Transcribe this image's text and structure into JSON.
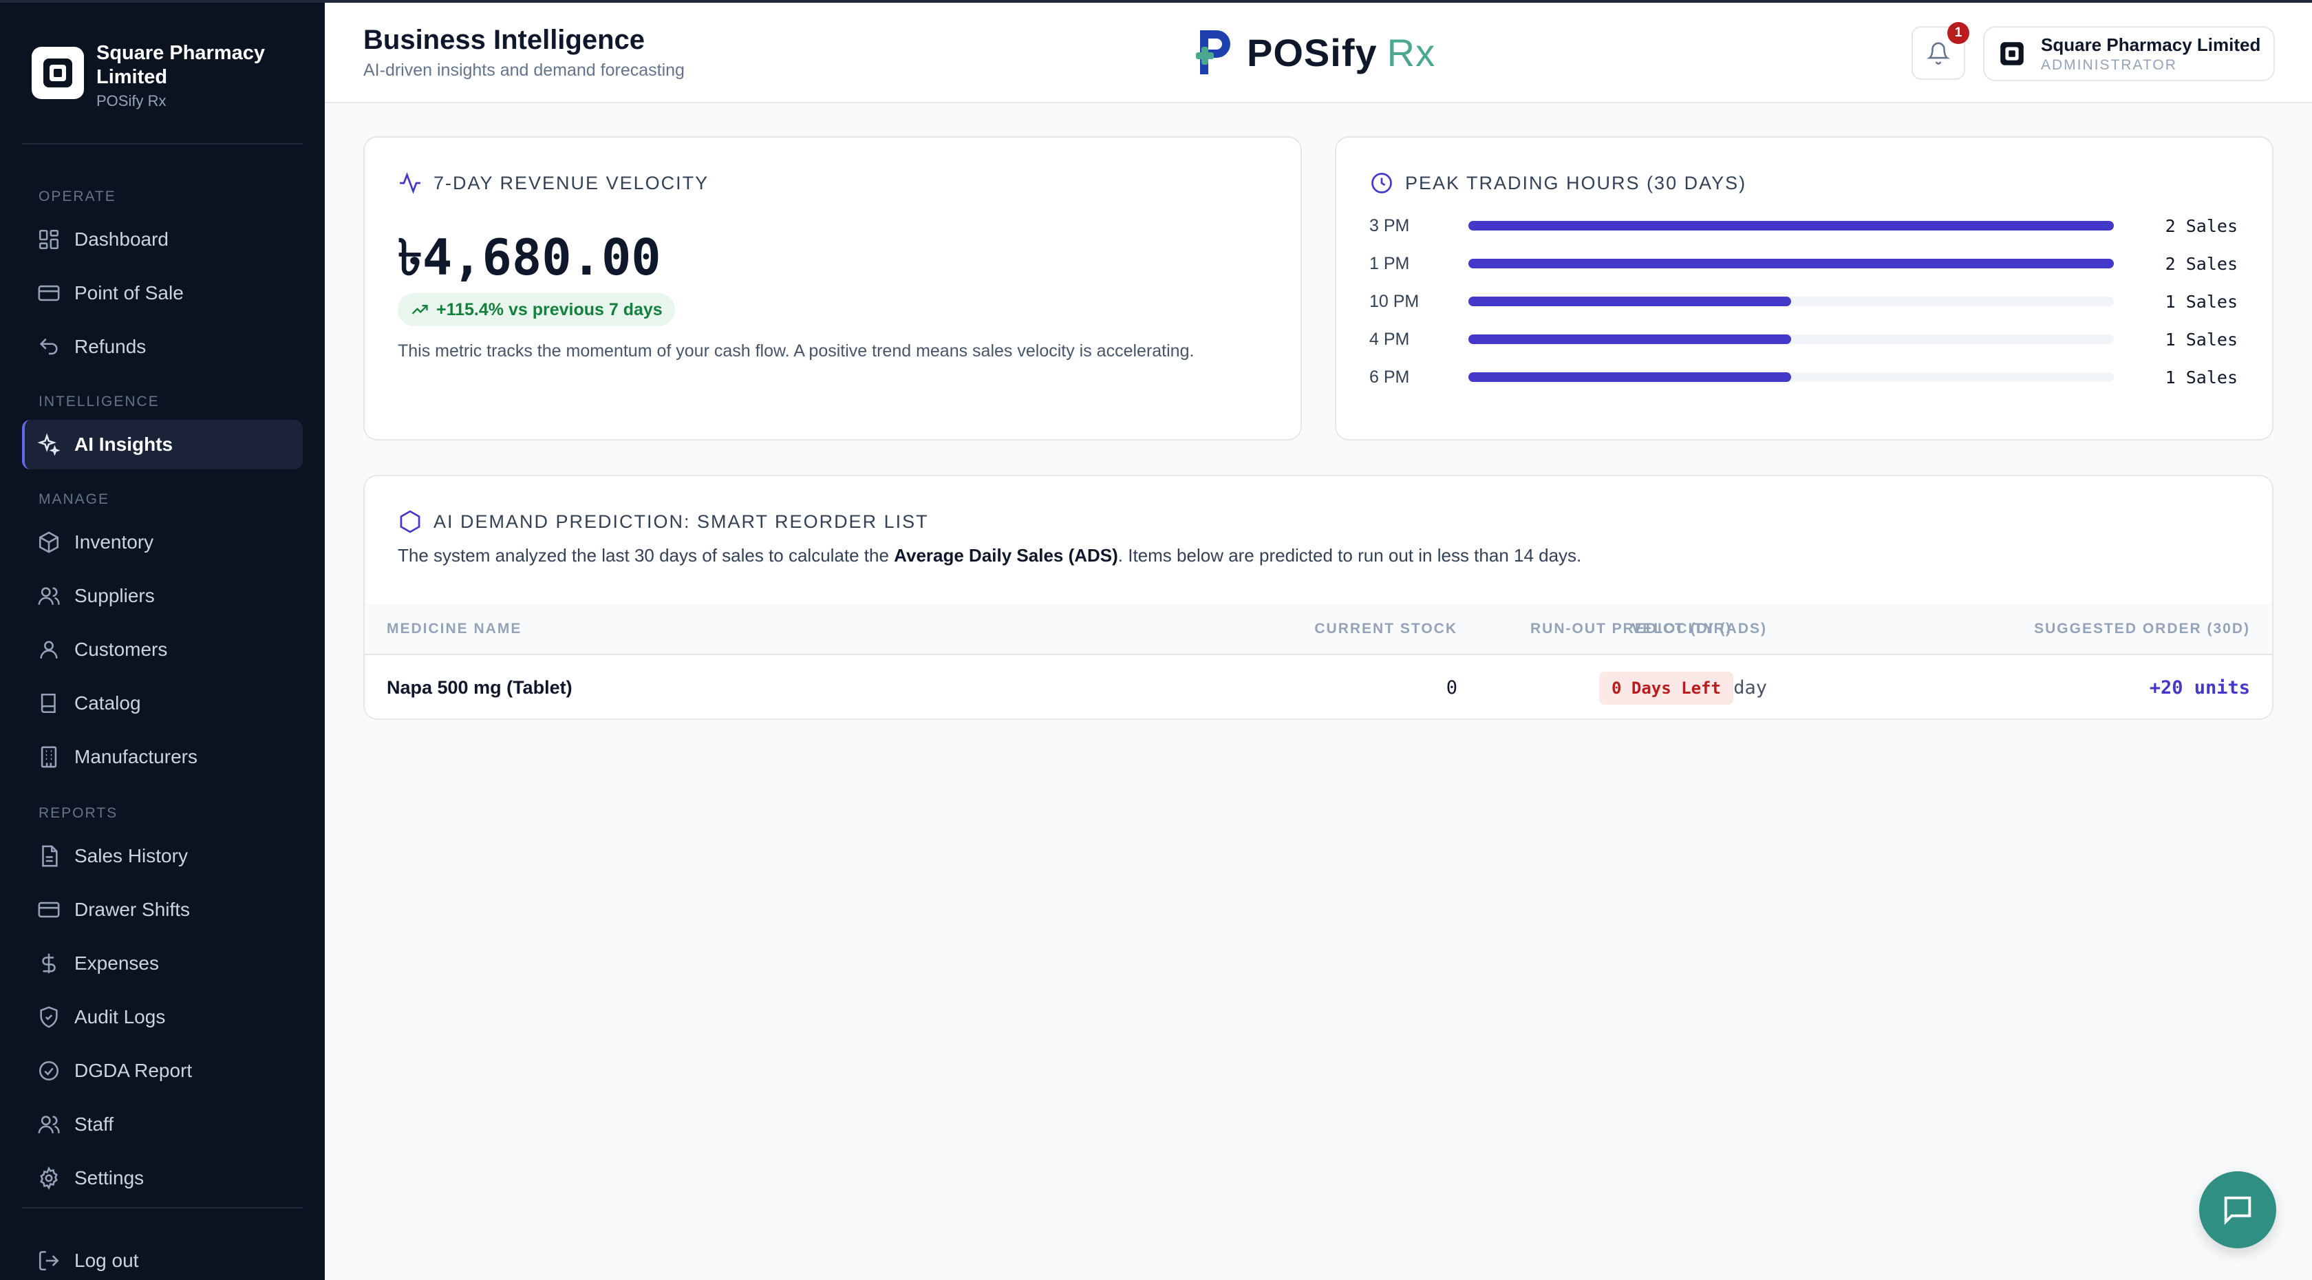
{
  "brand": {
    "name": "Square Pharmacy Limited",
    "product": "POSify Rx",
    "logo_icon": "square-logo-icon"
  },
  "sidebar": {
    "sections": {
      "operate": "OPERATE",
      "intelligence": "INTELLIGENCE",
      "manage": "MANAGE",
      "reports": "REPORTS"
    },
    "items": [
      {
        "label": "Dashboard",
        "icon": "grid-icon"
      },
      {
        "label": "Point of Sale",
        "icon": "card-icon"
      },
      {
        "label": "Refunds",
        "icon": "undo-icon"
      },
      {
        "label": "AI Insights",
        "icon": "sparkles-icon",
        "active": true
      },
      {
        "label": "Inventory",
        "icon": "box-icon"
      },
      {
        "label": "Suppliers",
        "icon": "users-icon"
      },
      {
        "label": "Customers",
        "icon": "user-icon"
      },
      {
        "label": "Catalog",
        "icon": "book-icon"
      },
      {
        "label": "Manufacturers",
        "icon": "building-icon"
      },
      {
        "label": "Sales History",
        "icon": "file-icon"
      },
      {
        "label": "Drawer Shifts",
        "icon": "card-icon"
      },
      {
        "label": "Expenses",
        "icon": "dollar-icon"
      },
      {
        "label": "Audit Logs",
        "icon": "shield-icon"
      },
      {
        "label": "DGDA Report",
        "icon": "check-circle-icon"
      },
      {
        "label": "Staff",
        "icon": "users-icon"
      },
      {
        "label": "Settings",
        "icon": "gear-icon"
      }
    ],
    "logout": "Log out"
  },
  "header": {
    "title": "Business Intelligence",
    "subtitle": "AI-driven insights and demand forecasting",
    "logo_main": "POSify",
    "logo_rx": "Rx",
    "notification_count": "1",
    "user_name": "Square Pharmacy Limited",
    "user_role": "ADMINISTRATOR"
  },
  "revenue": {
    "title": "7-DAY REVENUE VELOCITY",
    "value": "৳4,680.00",
    "growth": "+115.4% vs previous 7 days",
    "note": "This metric tracks the momentum of your cash flow. A positive trend means sales velocity is accelerating."
  },
  "peak_hours": {
    "title": "PEAK TRADING HOURS (30 DAYS)",
    "rows": [
      {
        "hour": "3 PM",
        "count": "2 Sales",
        "fraction": 1.0
      },
      {
        "hour": "1 PM",
        "count": "2 Sales",
        "fraction": 1.0
      },
      {
        "hour": "10 PM",
        "count": "1 Sales",
        "fraction": 0.5
      },
      {
        "hour": "4 PM",
        "count": "1 Sales",
        "fraction": 0.5
      },
      {
        "hour": "6 PM",
        "count": "1 Sales",
        "fraction": 0.5
      }
    ]
  },
  "reorder": {
    "title": "AI DEMAND PREDICTION: SMART REORDER LIST",
    "desc_before": "The system analyzed the last 30 days of sales to calculate the ",
    "desc_bold": "Average Daily Sales (ADS)",
    "desc_after": ". Items below are predicted to run out in less than 14 days.",
    "columns": {
      "medicine": "MEDICINE NAME",
      "stock": "CURRENT STOCK",
      "velocity": "VELOCITY (ADS)",
      "runout": "RUN-OUT PREDICT (DIR)",
      "suggested": "SUGGESTED ORDER (30D)"
    },
    "rows": [
      {
        "medicine": "Napa 500 mg (Tablet)",
        "stock": "0",
        "velocity": "0.67 / day",
        "runout": "0 Days Left",
        "suggested": "+20 units"
      }
    ]
  },
  "colors": {
    "accent": "#4338ca",
    "sidebar": "#0b1220",
    "success": "#15803d",
    "danger": "#b91c1c",
    "chat": "#2f8f83"
  }
}
